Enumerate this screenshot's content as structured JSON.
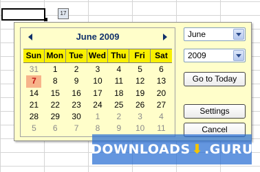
{
  "calendar": {
    "launch_label": "17",
    "title": "June 2009",
    "weekdays": [
      "Sun",
      "Mon",
      "Tue",
      "Wed",
      "Thu",
      "Fri",
      "Sat"
    ],
    "weeks": [
      [
        "31",
        "1",
        "2",
        "3",
        "4",
        "5",
        "6"
      ],
      [
        "7",
        "8",
        "9",
        "10",
        "11",
        "12",
        "13"
      ],
      [
        "14",
        "15",
        "16",
        "17",
        "18",
        "19",
        "20"
      ],
      [
        "21",
        "22",
        "23",
        "24",
        "25",
        "26",
        "27"
      ],
      [
        "28",
        "29",
        "30",
        "1",
        "2",
        "3",
        "4"
      ],
      [
        "5",
        "6",
        "7",
        "8",
        "9",
        "10",
        "11"
      ]
    ],
    "today": "7",
    "header_color": "#f8f000",
    "today_color": "#f7b38a"
  },
  "controls": {
    "month_select": "June",
    "year_select": "2009",
    "goto_today": "Go to Today",
    "settings": "Settings",
    "cancel": "Cancel"
  },
  "watermark": {
    "left": "DOWNLOADS",
    "right": ".GURU"
  }
}
